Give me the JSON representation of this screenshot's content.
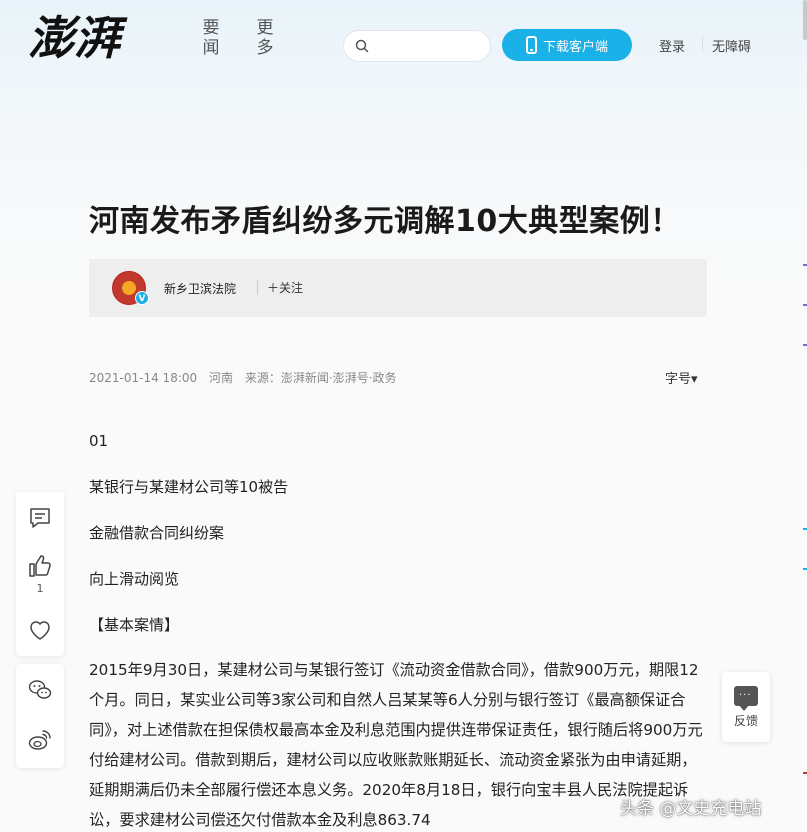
{
  "header": {
    "logo_text": "澎湃",
    "nav": [
      {
        "label": "要闻"
      },
      {
        "label": "更多"
      }
    ],
    "search_placeholder": "",
    "download_label": "下载客户端",
    "login_label": "登录",
    "accessibility_label": "无障碍"
  },
  "article": {
    "title": "河南发布矛盾纠纷多元调解10大典型案例！",
    "author": {
      "name": "新乡卫滨法院",
      "verified_mark": "V",
      "follow_label": "关注"
    },
    "meta": {
      "datetime": "2021-01-14 18:00",
      "location": "河南",
      "source": "来源：澎湃新闻·澎湃号·政务"
    },
    "font_size_label": "字号",
    "paragraphs": [
      "01",
      "某银行与某建材公司等10被告",
      "金融借款合同纠纷案",
      "向上滑动阅览",
      "【基本案情】"
    ],
    "body_text": "2015年9月30日，某建材公司与某银行签订《流动资金借款合同》，借款900万元，期限12个月。同日，某实业公司等3家公司和自然人吕某某等6人分别与银行签订《最高额保证合同》，对上述借款在担保债权最高本金及利息范围内提供连带保证责任，银行随后将900万元付给建材公司。借款到期后，建材公司以应收账款账期延长、流动资金紧张为由申请延期，延期期满后仍未全部履行偿还本息义务。2020年8月18日，银行向宝丰县人民法院提起诉讼，要求建材公司偿还欠付借款本金及利息863.74"
  },
  "toolbar": {
    "like_count": "1"
  },
  "feedback": {
    "label": "反馈"
  },
  "watermark": "头条 @文史充电站",
  "colors": {
    "accent": "#1ab0e8",
    "title": "#1a1a1a",
    "meta": "#888888",
    "author_bar": "#eeeeee"
  }
}
